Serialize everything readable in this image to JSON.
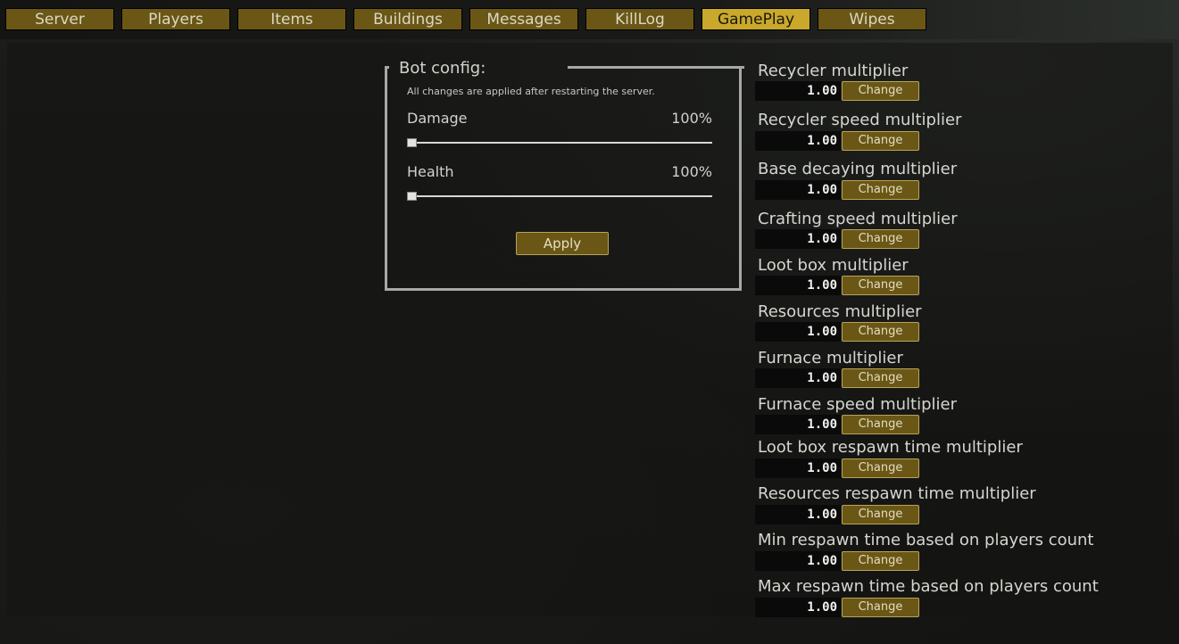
{
  "tabs": [
    {
      "label": "Server",
      "active": false
    },
    {
      "label": "Players",
      "active": false
    },
    {
      "label": "Items",
      "active": false
    },
    {
      "label": "Buildings",
      "active": false
    },
    {
      "label": "Messages",
      "active": false
    },
    {
      "label": "KillLog",
      "active": false
    },
    {
      "label": "GamePlay",
      "active": true
    },
    {
      "label": "Wipes",
      "active": false
    }
  ],
  "bot_config": {
    "title": "Bot config:",
    "note": "All changes are applied after restarting the server.",
    "damage_label": "Damage",
    "damage_value": "100%",
    "health_label": "Health",
    "health_value": "100%",
    "apply_label": "Apply"
  },
  "settings": [
    {
      "label": "Recycler multiplier",
      "value": "1.00",
      "button": "Change"
    },
    {
      "label": "Recycler speed multiplier",
      "value": "1.00",
      "button": "Change"
    },
    {
      "label": "Base decaying multiplier",
      "value": "1.00",
      "button": "Change"
    },
    {
      "label": "Crafting speed multiplier",
      "value": "1.00",
      "button": "Change"
    },
    {
      "label": "Loot box multiplier",
      "value": "1.00",
      "button": "Change"
    },
    {
      "label": "Resources multiplier",
      "value": "1.00",
      "button": "Change"
    },
    {
      "label": "Furnace multiplier",
      "value": "1.00",
      "button": "Change"
    },
    {
      "label": "Furnace speed multiplier",
      "value": "1.00",
      "button": "Change"
    },
    {
      "label": "Loot box respawn time multiplier",
      "value": "1.00",
      "button": "Change"
    },
    {
      "label": "Resources respawn time multiplier",
      "value": "1.00",
      "button": "Change"
    },
    {
      "label": "Min respawn time based on players count",
      "value": "1.00",
      "button": "Change"
    },
    {
      "label": "Max respawn time based on players count",
      "value": "1.00",
      "button": "Change"
    }
  ],
  "colors": {
    "tab": "#6a5716",
    "tab_active": "#c9a82c",
    "button": "#6a5716",
    "text": "#d6d6d0"
  }
}
